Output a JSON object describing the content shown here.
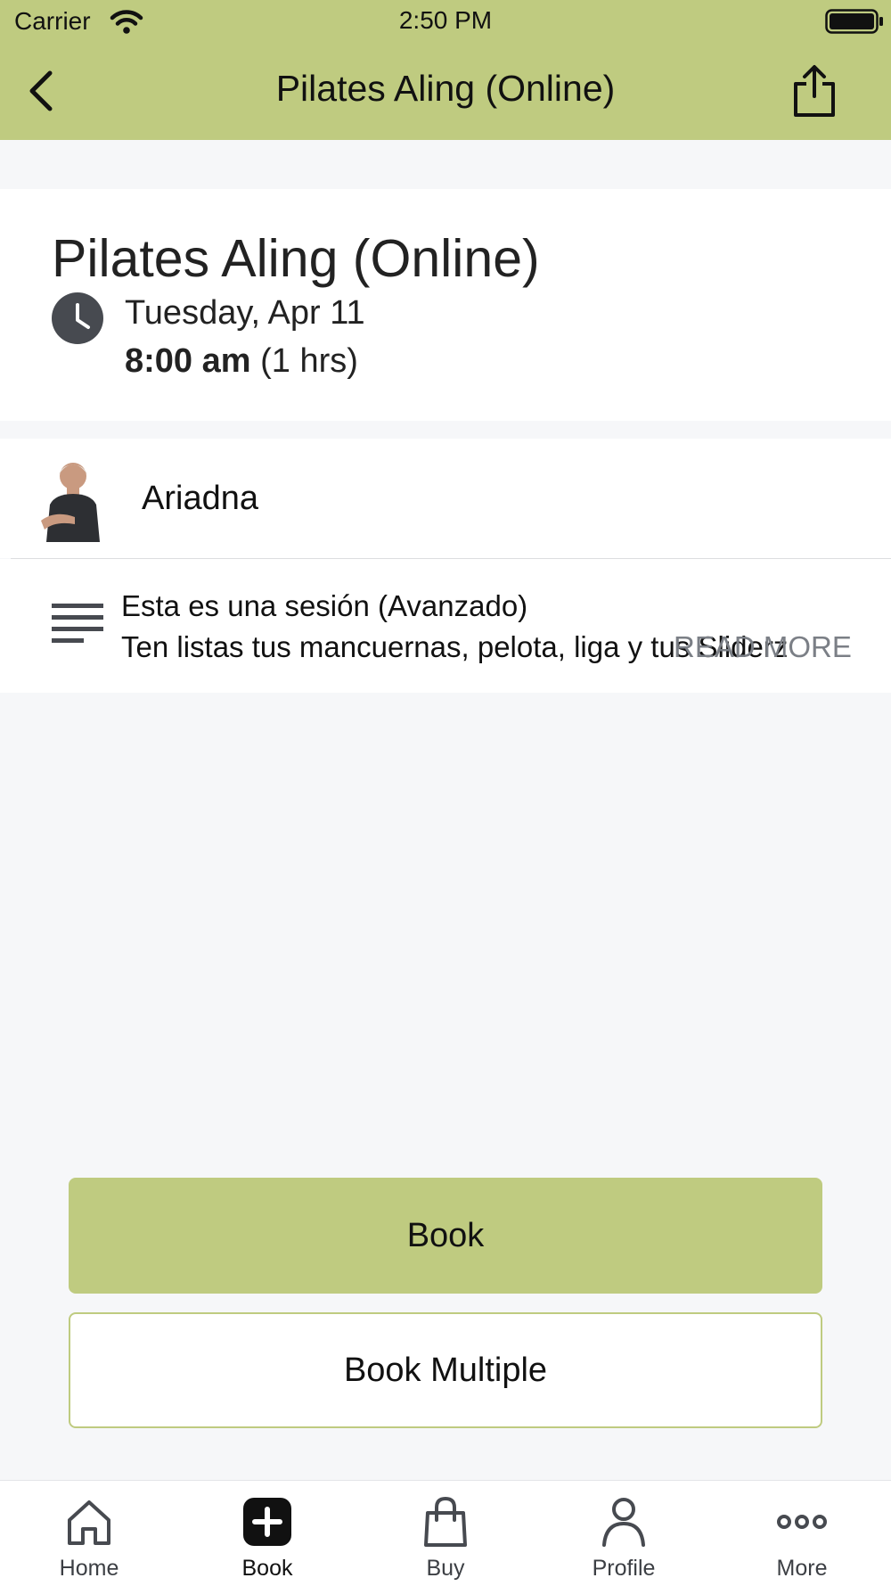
{
  "status_bar": {
    "carrier": "Carrier",
    "time": "2:50 PM"
  },
  "nav": {
    "title": "Pilates Aling (Online)"
  },
  "class": {
    "title": "Pilates Aling (Online)",
    "date": "Tuesday, Apr 11",
    "start_time": "8:00 am",
    "duration": "(1 hrs)"
  },
  "instructor": {
    "name": "Ariadna"
  },
  "description": {
    "line1": "Esta es una sesión (Avanzado)",
    "line2": "Ten listas tus mancuernas, pelota, liga y tus Sliderz",
    "read_more": "READ MORE"
  },
  "buttons": {
    "book": "Book",
    "book_multiple": "Book Multiple"
  },
  "tabs": [
    {
      "label": "Home",
      "icon": "home-icon"
    },
    {
      "label": "Book",
      "icon": "plus-square-icon"
    },
    {
      "label": "Buy",
      "icon": "shopping-bag-icon"
    },
    {
      "label": "Profile",
      "icon": "person-icon"
    },
    {
      "label": "More",
      "icon": "more-dots-icon"
    }
  ],
  "colors": {
    "accent": "#bfcb80",
    "background": "#f6f7f9",
    "icon_dark": "#474a50"
  }
}
